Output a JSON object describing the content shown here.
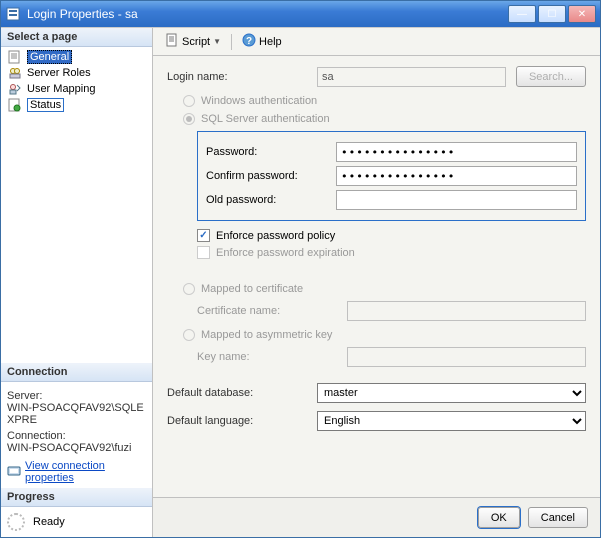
{
  "window": {
    "title": "Login Properties - sa"
  },
  "sidebar": {
    "select_page_header": "Select a page",
    "pages": [
      {
        "label": "General",
        "icon": "page-icon"
      },
      {
        "label": "Server Roles",
        "icon": "roles-icon"
      },
      {
        "label": "User Mapping",
        "icon": "mapping-icon"
      },
      {
        "label": "Status",
        "icon": "status-icon"
      }
    ],
    "connection_header": "Connection",
    "connection": {
      "server_label": "Server:",
      "server_value": "WIN-PSOACQFAV92\\SQLEXPRE",
      "connection_label": "Connection:",
      "connection_value": "WIN-PSOACQFAV92\\fuzi",
      "view_link": "View connection properties"
    },
    "progress_header": "Progress",
    "progress_status": "Ready"
  },
  "toolbar": {
    "script_label": "Script",
    "help_label": "Help"
  },
  "form": {
    "login_name_label": "Login name:",
    "login_name_value": "sa",
    "search_button": "Search...",
    "windows_auth_label": "Windows authentication",
    "sql_auth_label": "SQL Server authentication",
    "password_label": "Password:",
    "password_value": "•••••••••••••••",
    "confirm_password_label": "Confirm password:",
    "confirm_password_value": "•••••••••••••••",
    "old_password_label": "Old password:",
    "old_password_value": "",
    "enforce_policy_label": "Enforce password policy",
    "enforce_expiration_label": "Enforce password expiration",
    "mapped_cert_label": "Mapped to certificate",
    "certificate_name_label": "Certificate name:",
    "mapped_asym_label": "Mapped to asymmetric key",
    "key_name_label": "Key name:",
    "default_db_label": "Default database:",
    "default_db_value": "master",
    "default_lang_label": "Default language:",
    "default_lang_value": "English"
  },
  "buttons": {
    "ok": "OK",
    "cancel": "Cancel"
  }
}
